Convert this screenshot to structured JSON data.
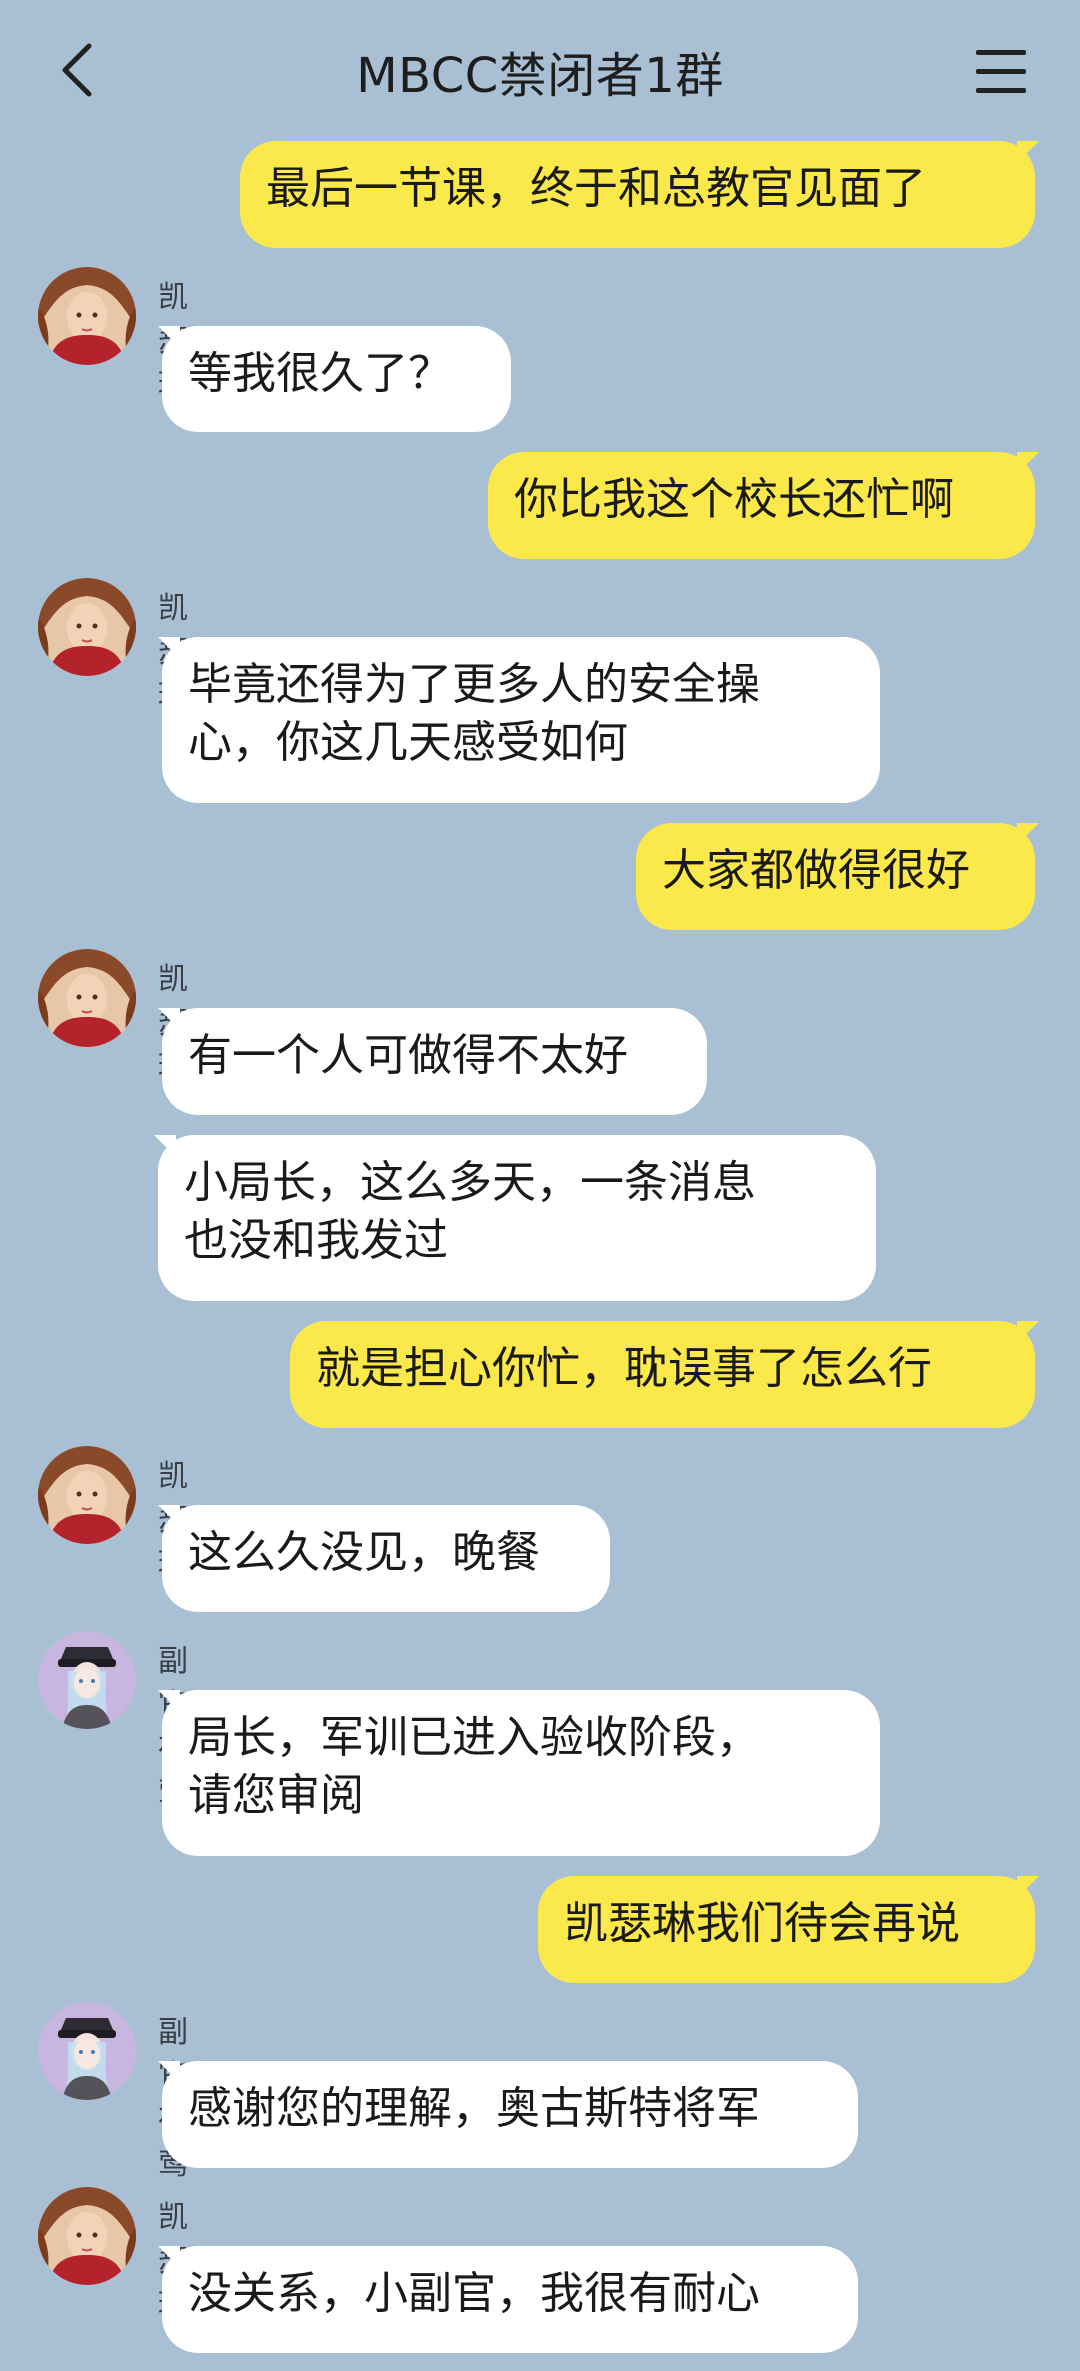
{
  "header": {
    "title": "MBCC禁闭者1群",
    "back_icon": "chevron-left-icon",
    "menu_icon": "hamburger-menu-icon"
  },
  "colors": {
    "background": "#a9bfd3",
    "outgoing_bubble": "#fbe94c",
    "incoming_bubble": "#ffffff"
  },
  "messages": [
    {
      "side": "out",
      "text": "最后一节课，终于和总教官见面了"
    },
    {
      "side": "in",
      "sender": "凯瑟琳",
      "avatar": "catherine-avatar",
      "text": "等我很久了？"
    },
    {
      "side": "out",
      "text": "你比我这个校长还忙啊"
    },
    {
      "side": "in",
      "sender": "凯瑟琳",
      "avatar": "catherine-avatar",
      "text": "毕竟还得为了更多人的安全操\n心，你这几天感受如何"
    },
    {
      "side": "out",
      "text": "大家都做得很好"
    },
    {
      "side": "in",
      "sender": "凯瑟琳",
      "avatar": "catherine-avatar",
      "text": "有一个人可做得不太好"
    },
    {
      "side": "in",
      "text": "小局长，这么多天，一条消息\n也没和我发过"
    },
    {
      "side": "out",
      "text": "就是担心你忙，耽误事了怎么行"
    },
    {
      "side": "in",
      "sender": "凯瑟琳",
      "avatar": "catherine-avatar",
      "text": "这么久没见，晚餐"
    },
    {
      "side": "in",
      "sender": "副官夜莺",
      "avatar": "nightingale-avatar",
      "text": "局长，军训已进入验收阶段，\n请您审阅"
    },
    {
      "side": "out",
      "text": "凯瑟琳我们待会再说"
    },
    {
      "side": "in",
      "sender": "副官夜莺",
      "avatar": "nightingale-avatar",
      "text": "感谢您的理解，奥古斯特将军"
    },
    {
      "side": "in",
      "sender": "凯瑟琳",
      "avatar": "catherine-avatar",
      "text": "没关系，小副官，我很有耐心"
    }
  ]
}
